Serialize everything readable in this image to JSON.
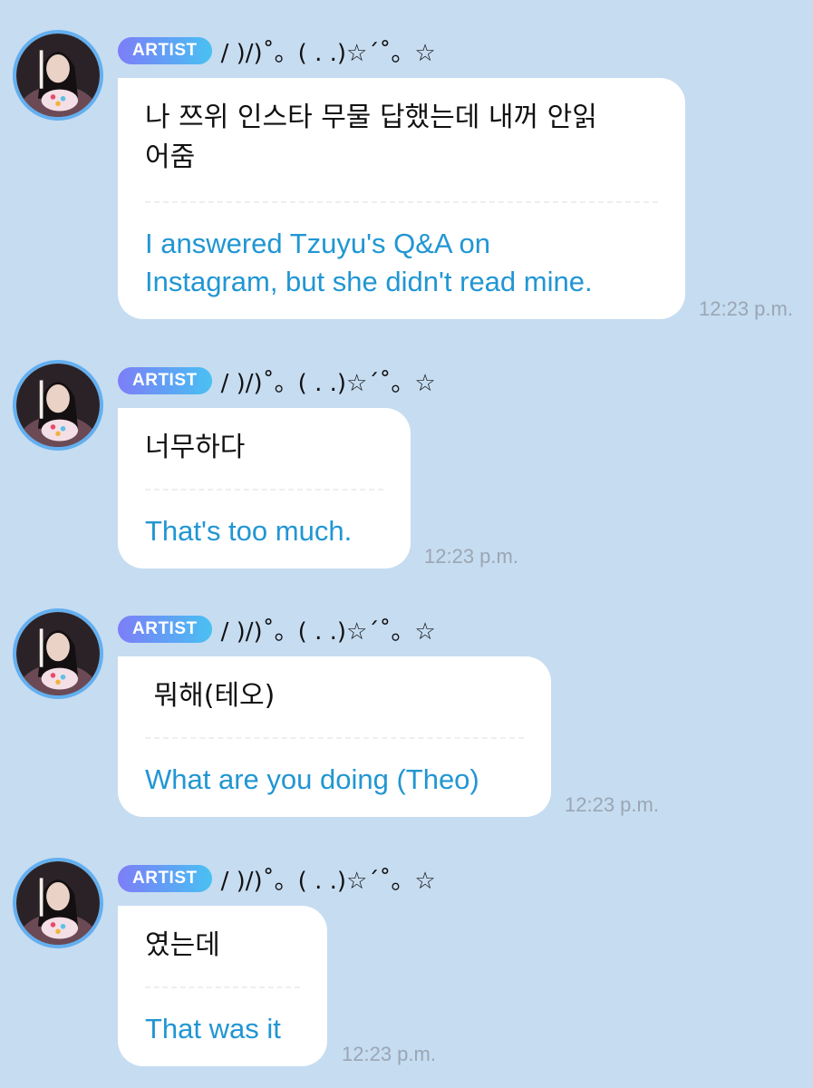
{
  "messages": [
    {
      "badge": "ARTIST",
      "nickname": "/ )/)˚。( . .)☆´˚。☆",
      "original": "나 쯔위 인스타 무물 답했는데 내꺼 안읽\n어줌",
      "translation": "I answered Tzuyu's Q&A on\nInstagram, but she didn't read mine.",
      "time": "12:23 p.m.",
      "avatar": "profile-photo"
    },
    {
      "badge": "ARTIST",
      "nickname": "/ )/)˚。( . .)☆´˚。☆",
      "original": "너무하다",
      "translation": "That's too much.",
      "time": "12:23 p.m.",
      "avatar": "profile-photo"
    },
    {
      "badge": "ARTIST",
      "nickname": "/ )/)˚。( . .)☆´˚。☆",
      "original": " 뭐해(테오)",
      "translation": "What are you doing (Theo)",
      "time": "12:23 p.m.",
      "avatar": "profile-photo"
    },
    {
      "badge": "ARTIST",
      "nickname": "/ )/)˚。( . .)☆´˚。☆",
      "original": "였는데",
      "translation": "That was it",
      "time": "12:23 p.m.",
      "avatar": "profile-photo"
    }
  ],
  "colors": {
    "background": "#c6dcf1",
    "avatar_ring": "#63aff0",
    "translation_text": "#2196d3",
    "timestamp": "#9aa6b4",
    "badge_gradient": [
      "#7d7ef7",
      "#49c1f2"
    ]
  }
}
